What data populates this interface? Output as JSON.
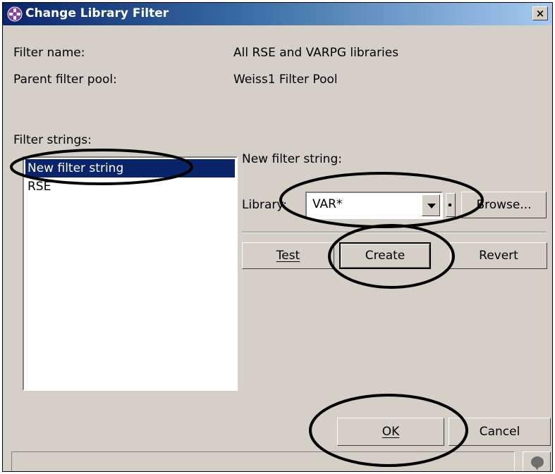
{
  "window": {
    "title": "Change Library Filter",
    "close_label": "×",
    "title_color": "#0a246a"
  },
  "form": {
    "filter_name_label": "Filter name:",
    "filter_name_value": "All RSE and VARPG libraries",
    "parent_pool_label": "Parent filter pool:",
    "parent_pool_value": "Weiss1 Filter Pool",
    "filter_strings_label": "Filter strings:",
    "filter_strings": [
      {
        "label": "New filter string",
        "selected": true
      },
      {
        "label": "RSE",
        "selected": false
      }
    ],
    "new_filter_string_label": "New filter string:",
    "library_label": "Library:",
    "library_value": "VAR*",
    "browse_label": "Browse...",
    "test_label": "Test",
    "create_label": "Create",
    "revert_label": "Revert"
  },
  "footer": {
    "ok_label": "OK",
    "cancel_label": "Cancel",
    "help_icon": "help-bubble-icon"
  }
}
